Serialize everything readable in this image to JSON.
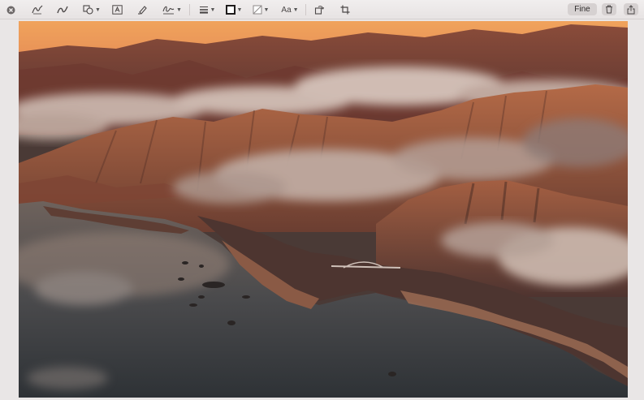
{
  "toolbar": {
    "done_label": "Fine",
    "text_style_label": "Aa",
    "tools": [
      {
        "name": "close-icon"
      },
      {
        "name": "sketch-icon"
      },
      {
        "name": "draw-icon"
      },
      {
        "name": "shapes-icon"
      },
      {
        "name": "text-box-icon"
      },
      {
        "name": "highlight-icon"
      },
      {
        "name": "signature-icon"
      },
      {
        "name": "line-style-icon"
      },
      {
        "name": "border-color-icon"
      },
      {
        "name": "fill-color-icon"
      },
      {
        "name": "text-style-icon"
      },
      {
        "name": "rotate-icon"
      },
      {
        "name": "crop-icon"
      },
      {
        "name": "trash-icon"
      },
      {
        "name": "share-icon"
      }
    ]
  },
  "document": {
    "image": "aerial coastal landscape photo (Big Sur)"
  },
  "colors": {
    "toolbar_bg": "#ece8e8",
    "button_bg": "#d6d1d1",
    "icon": "#4b4747"
  }
}
